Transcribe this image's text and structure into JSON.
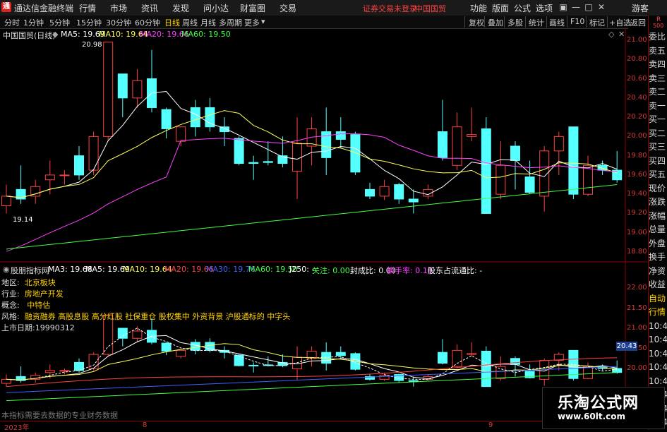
{
  "menubar": {
    "app_title": "通达信金融终端",
    "logo_text": "通",
    "items": [
      "行情",
      "市场",
      "资讯",
      "发现",
      "问小达",
      "财富圈",
      "交易"
    ],
    "login_text": "证券交易未登录",
    "stock_name": "中国国贸",
    "right_items": [
      "功能",
      "版面",
      "公式",
      "选项"
    ],
    "user": "游客"
  },
  "period_bar": {
    "periods": [
      "分时",
      "1分钟",
      "5分钟",
      "15分钟",
      "30分钟",
      "60分钟",
      "日线",
      "周线",
      "月线",
      "多周期",
      "更多"
    ],
    "active": "日线",
    "tools": [
      "复权",
      "叠加",
      "多股",
      "统计",
      "画线",
      "F10",
      "标记",
      "+自选",
      "返回"
    ]
  },
  "right_panel": {
    "items": [
      "委比",
      "卖五",
      "卖四",
      "卖三",
      "卖二",
      "卖一",
      "买一",
      "买二",
      "买三",
      "买四",
      "买五",
      "现价",
      "涨跌",
      "涨幅",
      "总量",
      "外盘",
      "换手",
      "净资",
      "收益",
      "自动",
      "行情",
      "10:44",
      "10:45",
      "10:45",
      "10:45",
      "10:45",
      "10:45",
      "10:45",
      "10:45"
    ],
    "top_label_r": "R",
    "top_label_num": "500"
  },
  "main_chart": {
    "title": "中国国贸(日线)",
    "ma5": "MA5: 19.69",
    "ma10": "MA10: 19.64",
    "ma20": "MA20: 19.66",
    "ma60": "MA60: 19.50",
    "high_label": "20.98",
    "low_label": "19.14",
    "y_ticks": [
      "21.00",
      "20.80",
      "20.60",
      "20.40",
      "20.20",
      "20.00",
      "19.80",
      "19.60",
      "19.40",
      "19.20",
      "19.00",
      "18.80"
    ]
  },
  "indicator": {
    "name": "股朋指标网",
    "ma3": "MA3: 19.68",
    "ma5": "MA5: 19.69",
    "ma10": "MA10: 19.64",
    "ma20": "MA20: 19.66",
    "ma30": "MA30: 19.76",
    "ma60": "MA60: 19.50",
    "j250": "J250: -",
    "guanzhu": "关注: 0.00",
    "fengcheng": "封成比: 0.00",
    "huanshou": "换手率: 0.10",
    "gudong": "股东占流通比: -",
    "region_label": "地区:",
    "region": "北京板块",
    "industry_label": "行业:",
    "industry": "房地产开发",
    "concept_label": "概念:",
    "concept": "中特估",
    "style_label": "风格:",
    "style": "融资融券 高股息股 高分红股 社保重仓 股权集中 外资背景 沪股通标的 中字头",
    "ipo_label": "上市日期:",
    "ipo": "19990312",
    "footer": "本指标需要去数据的专业财务数据",
    "y_ticks": [
      "22.00",
      "21.50",
      "21.00",
      "20.50",
      "20.00"
    ],
    "price_tag": "20.43"
  },
  "date_axis": {
    "labels": [
      "2023年",
      "8",
      "9"
    ]
  },
  "watermark": {
    "line1": "乐淘公式网",
    "line2": "www.60lt.com"
  },
  "colors": {
    "up": "#ff4040",
    "down": "#54ffff",
    "ma5": "#ffffff",
    "ma10": "#ffff5a",
    "ma20": "#ff40ff",
    "ma60": "#40ff40",
    "accent": "#ffd200",
    "border": "#8b0000"
  },
  "chart_data": {
    "type": "candlestick",
    "ohlc": [
      [
        19.28,
        19.38,
        19.5,
        19.2
      ],
      [
        19.45,
        19.35,
        19.7,
        19.3
      ],
      [
        19.38,
        19.48,
        19.55,
        19.3
      ],
      [
        19.55,
        19.6,
        19.75,
        19.4
      ],
      [
        19.6,
        19.6,
        19.65,
        19.5
      ],
      [
        19.8,
        19.6,
        19.9,
        19.55
      ],
      [
        19.65,
        20.0,
        20.05,
        19.6
      ],
      [
        20.0,
        20.98,
        20.98,
        19.95
      ],
      [
        20.65,
        20.4,
        20.65,
        20.2
      ],
      [
        20.4,
        20.58,
        20.7,
        20.3
      ],
      [
        20.6,
        20.3,
        20.9,
        20.25
      ],
      [
        20.28,
        20.08,
        20.3,
        19.98
      ],
      [
        19.95,
        20.1,
        20.1,
        19.9
      ],
      [
        20.3,
        20.1,
        20.38,
        20.0
      ],
      [
        20.3,
        20.1,
        20.4,
        20.05
      ],
      [
        20.1,
        20.05,
        20.2,
        19.9
      ],
      [
        19.98,
        19.72,
        20.0,
        19.7
      ],
      [
        19.73,
        19.72,
        19.8,
        19.55
      ],
      [
        19.74,
        19.73,
        19.95,
        19.7
      ],
      [
        19.8,
        19.72,
        20.0,
        19.68
      ],
      [
        19.64,
        19.93,
        20.2,
        19.35
      ],
      [
        19.9,
        20.08,
        20.2,
        19.7
      ],
      [
        20.05,
        19.78,
        20.3,
        19.6
      ],
      [
        20.05,
        19.97,
        20.2,
        19.88
      ],
      [
        20.02,
        19.63,
        20.05,
        19.6
      ],
      [
        19.45,
        19.38,
        19.52,
        19.35
      ],
      [
        19.38,
        19.48,
        19.55,
        19.34
      ],
      [
        19.5,
        19.35,
        19.52,
        19.3
      ],
      [
        19.35,
        19.32,
        19.45,
        19.2
      ],
      [
        19.38,
        19.45,
        19.5,
        19.35
      ],
      [
        20.05,
        19.78,
        20.38,
        19.75
      ],
      [
        19.7,
        20.1,
        20.25,
        19.65
      ],
      [
        20.0,
        20.02,
        20.3,
        19.95
      ],
      [
        20.08,
        19.2,
        20.2,
        19.2
      ],
      [
        19.4,
        19.7,
        19.95,
        19.35
      ],
      [
        19.9,
        19.75,
        19.95,
        19.45
      ],
      [
        19.58,
        19.42,
        19.75,
        19.4
      ],
      [
        19.38,
        19.85,
        19.9,
        19.22
      ],
      [
        19.85,
        20.0,
        20.05,
        19.6
      ],
      [
        20.1,
        19.4,
        20.1,
        19.35
      ],
      [
        19.4,
        19.7,
        19.8,
        19.38
      ],
      [
        19.7,
        19.65,
        19.75,
        19.6
      ],
      [
        19.65,
        19.55,
        19.85,
        19.52
      ]
    ]
  }
}
